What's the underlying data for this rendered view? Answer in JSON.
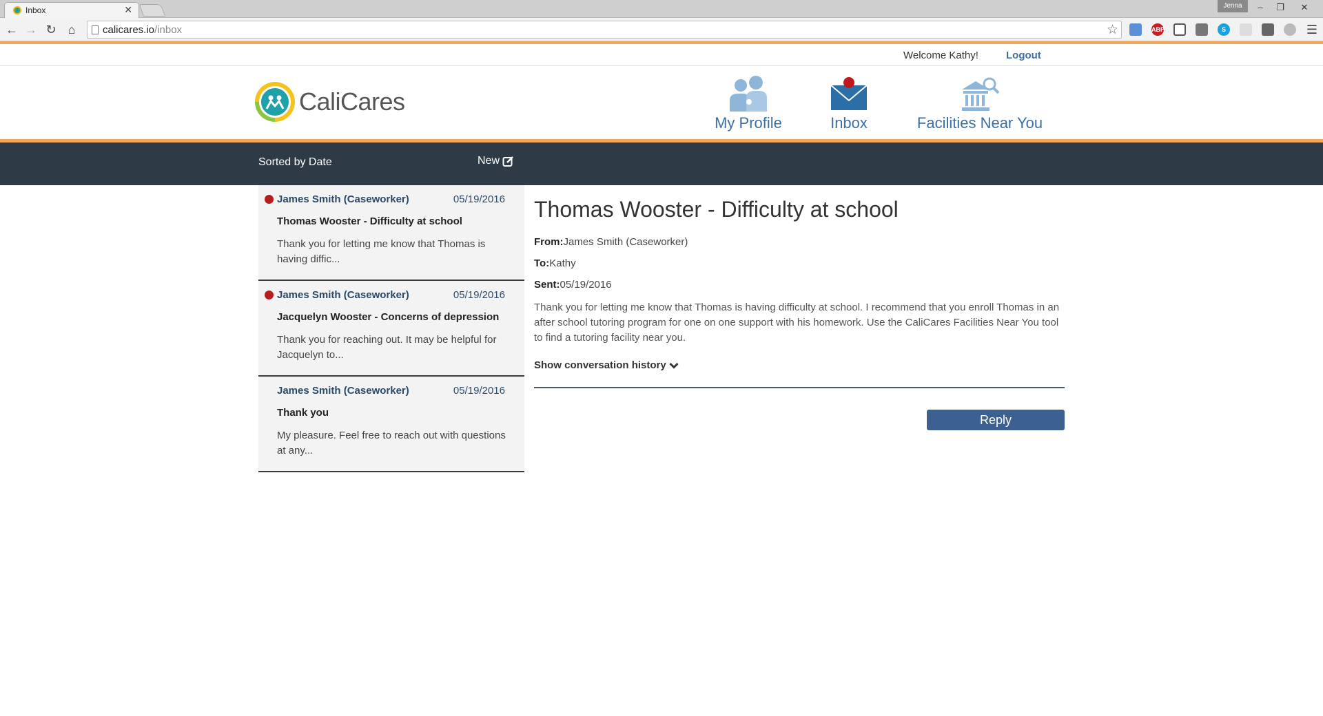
{
  "browser": {
    "tab_title": "Inbox",
    "tab_close": "✕",
    "user_name": "Jenna",
    "url_host": "calicares.io",
    "url_path": "/inbox",
    "window_buttons": [
      "–",
      "❐",
      "✕"
    ]
  },
  "header": {
    "welcome": "Welcome Kathy!",
    "logout": "Logout",
    "logo_text": "CaliCares",
    "nav": [
      {
        "label": "My Profile",
        "icon": "people-icon"
      },
      {
        "label": "Inbox",
        "icon": "envelope-icon"
      },
      {
        "label": "Facilities Near You",
        "icon": "building-search-icon"
      }
    ],
    "accent_color": "#f0a656",
    "brand_blue": "#3c6fa5"
  },
  "toolbar": {
    "sorted_label": "Sorted by Date",
    "new_label": "New"
  },
  "messages": [
    {
      "sender": "James Smith (Caseworker)",
      "date": "05/19/2016",
      "subject": "Thomas Wooster - Difficulty at school",
      "preview": "Thank you for letting me know that Thomas is having diffic...",
      "unread": true
    },
    {
      "sender": "James Smith (Caseworker)",
      "date": "05/19/2016",
      "subject": "Jacquelyn Wooster - Concerns of depression",
      "preview": "Thank you for reaching out. It may be helpful for Jacquelyn to...",
      "unread": true
    },
    {
      "sender": "James Smith (Caseworker)",
      "date": "05/19/2016",
      "subject": "Thank you",
      "preview": "My pleasure. Feel free to reach out with questions at any...",
      "unread": false
    }
  ],
  "detail": {
    "title": "Thomas Wooster - Difficulty at school",
    "from_label": "From:",
    "from": "James Smith (Caseworker)",
    "to_label": "To:",
    "to": "Kathy",
    "sent_label": "Sent:",
    "sent": "05/19/2016",
    "body": "Thank you for letting me know that Thomas is having difficulty at school. I recommend that you enroll Thomas in an after school tutoring program for one on one support with his homework. Use the CaliCares Facilities Near You tool to find a tutoring facility near you.",
    "history_label": "Show conversation history",
    "reply_label": "Reply"
  }
}
